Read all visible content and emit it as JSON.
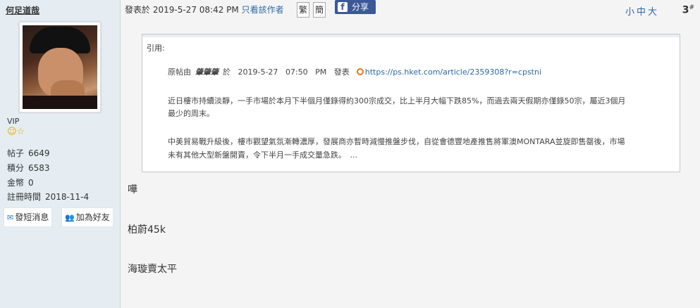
{
  "user": {
    "name": "何足道哉",
    "rank": "VIP",
    "badges": "☺☆",
    "stats": [
      {
        "label": "帖子",
        "value": "6649"
      },
      {
        "label": "積分",
        "value": "6583"
      },
      {
        "label": "金幣",
        "value": "0"
      },
      {
        "label": "註冊時間",
        "value": "2018-11-4"
      }
    ],
    "send_msg_label": "發短消息",
    "add_friend_label": "加為好友"
  },
  "post": {
    "posted_prefix": "發表於",
    "posted_time": "2019-5-27 08:42 PM",
    "only_author_label": "只看該作者",
    "trad_label": "繁",
    "simp_label": "簡",
    "share_label": "分享",
    "font_sizes": "小中大",
    "floor": "3",
    "floor_suffix": "#"
  },
  "quote": {
    "header": "引用:",
    "source_prefix": "原帖由",
    "author": "肇肇肇",
    "at_label": "於",
    "date": "2019-5-27",
    "time": "07:50",
    "ampm": "PM",
    "posted_label": "發表",
    "link": "https://ps.hket.com/article/2359308?r=cpstni",
    "para1_line1": "近日樓市持續淡靜，一手市場於本月下半個月僅錄得約300宗成交，比上半月大幅下跌85%，而過去兩天假期亦僅錄50宗，屬近3個月",
    "para1_line2": "最少的周末。",
    "para2_line1": "中美貿易戰升級後，樓市觀望氣氛漸轉濃厚，發展商亦暫時減慢推盤步伐，自從會德豐地產推售將軍澳MONTARA並旋即售罄後，市場",
    "para2_line2": "未有其他大型新盤開賣，令下半月一手成交量急跌。　..."
  },
  "messages": [
    "嘩",
    "柏蔚45k",
    "海璇賣太平"
  ]
}
